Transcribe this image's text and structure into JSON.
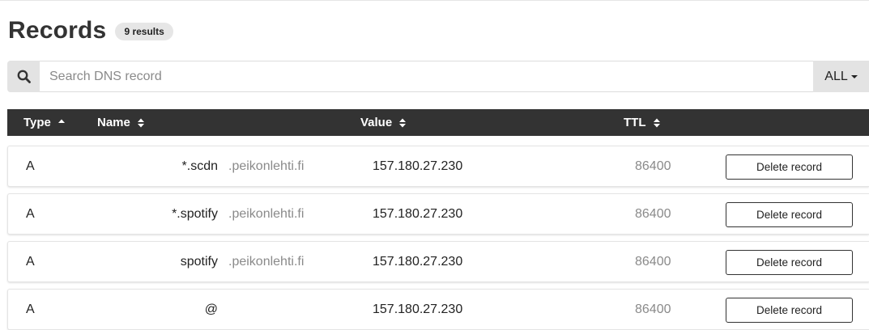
{
  "header": {
    "title": "Records",
    "results_badge": "9 results"
  },
  "search": {
    "placeholder": "Search DNS record",
    "value": "",
    "filter_label": "ALL"
  },
  "table": {
    "columns": {
      "type": "Type",
      "name": "Name",
      "value": "Value",
      "ttl": "TTL"
    },
    "sort": {
      "column": "Type",
      "direction": "ascending"
    },
    "rows": [
      {
        "type": "A",
        "subdomain": "*.scdn",
        "domain": ".peikonlehti.fi",
        "value": "157.180.27.230",
        "ttl": "86400",
        "action": "Delete record"
      },
      {
        "type": "A",
        "subdomain": "*.spotify",
        "domain": ".peikonlehti.fi",
        "value": "157.180.27.230",
        "ttl": "86400",
        "action": "Delete record"
      },
      {
        "type": "A",
        "subdomain": "spotify",
        "domain": ".peikonlehti.fi",
        "value": "157.180.27.230",
        "ttl": "86400",
        "action": "Delete record"
      },
      {
        "type": "A",
        "subdomain": "@",
        "domain": "",
        "value": "157.180.27.230",
        "ttl": "86400",
        "action": "Delete record"
      }
    ]
  },
  "colors": {
    "header_bg": "#333333",
    "muted_text": "#8a8a8a",
    "search_addon_bg": "#e3e3e3"
  }
}
